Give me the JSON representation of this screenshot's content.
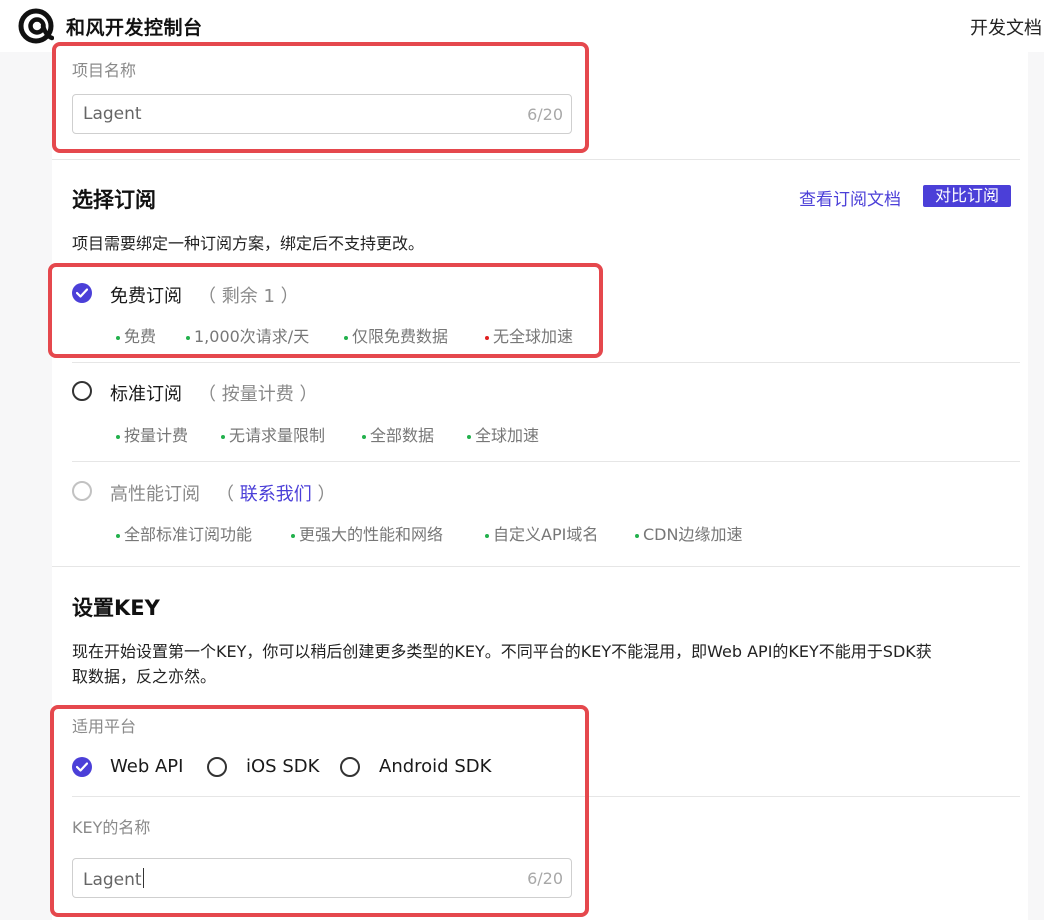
{
  "header": {
    "brand": "和风开发控制台",
    "docs_link": "开发文档",
    "logo_icon": "hefeng-logo-icon"
  },
  "project": {
    "label": "项目名称",
    "value": "Lagent",
    "counter": "6/20"
  },
  "subscription": {
    "title": "选择订阅",
    "view_docs": "查看订阅文档",
    "compare_button": "对比订阅",
    "description": "项目需要绑定一种订阅方案，绑定后不支持更改。",
    "options": [
      {
        "title": "免费订阅",
        "sub_prefix": "（ 剩余 1 ）",
        "sub_link": "",
        "sub_suffix": "",
        "state": "checked",
        "features": [
          {
            "text": "免费",
            "color": "#22b14c"
          },
          {
            "text": "1,000次请求/天",
            "color": "#22b14c"
          },
          {
            "text": "仅限免费数据",
            "color": "#22b14c"
          },
          {
            "text": "无全球加速",
            "color": "#e02020"
          }
        ]
      },
      {
        "title": "标准订阅",
        "sub_prefix": "（ 按量计费 ）",
        "sub_link": "",
        "sub_suffix": "",
        "state": "unchecked",
        "features": [
          {
            "text": "按量计费",
            "color": "#22b14c"
          },
          {
            "text": "无请求量限制",
            "color": "#22b14c"
          },
          {
            "text": "全部数据",
            "color": "#22b14c"
          },
          {
            "text": "全球加速",
            "color": "#22b14c"
          }
        ]
      },
      {
        "title": "高性能订阅",
        "sub_prefix": "（ ",
        "sub_link": "联系我们",
        "sub_suffix": " ）",
        "state": "disabled",
        "features": [
          {
            "text": "全部标准订阅功能",
            "color": "#22b14c"
          },
          {
            "text": "更强大的性能和网络",
            "color": "#22b14c"
          },
          {
            "text": "自定义API域名",
            "color": "#22b14c"
          },
          {
            "text": "CDN边缘加速",
            "color": "#22b14c"
          }
        ]
      }
    ]
  },
  "key": {
    "title": "设置KEY",
    "description_line1": "现在开始设置第一个KEY，你可以稍后创建更多类型的KEY。不同平台的KEY不能混用，即Web API的KEY不能用于SDK获",
    "description_line2": "取数据，反之亦然。",
    "platform_label": "适用平台",
    "platforms": [
      {
        "label": "Web API",
        "checked": true
      },
      {
        "label": "iOS SDK",
        "checked": false
      },
      {
        "label": "Android SDK",
        "checked": false
      }
    ],
    "name_label": "KEY的名称",
    "name_value": "Lagent",
    "name_counter": "6/20"
  },
  "colors": {
    "accent": "#4b3fd8",
    "highlight": "#e5484d",
    "feature_ok": "#22b14c",
    "feature_no": "#e02020"
  }
}
